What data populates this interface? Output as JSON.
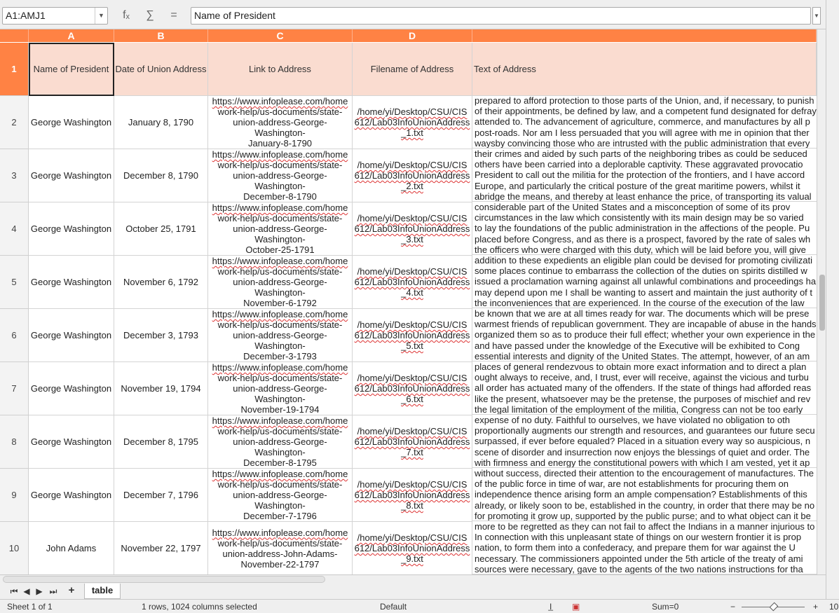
{
  "namebox": {
    "value": "A1:AMJ1"
  },
  "formula": {
    "content": "Name of President",
    "fx_icon": "fₓ",
    "sum_icon": "∑",
    "eq_icon": "="
  },
  "columns": [
    "A",
    "B",
    "C",
    "D",
    ""
  ],
  "header_row": {
    "num": "1",
    "cells": [
      "Name of President",
      "Date of Union Address",
      "Link to Address",
      "Filename of Address",
      "Text of Address"
    ]
  },
  "rows": [
    {
      "num": "2",
      "name": "George Washington",
      "date": "January 8, 1790",
      "link": [
        "https://www.infoplease.com/home",
        "work-help/us-documents/state-",
        "union-address-George-Washington-",
        "January-8-1790"
      ],
      "file": [
        "/home/yi/Desktop/CSU/CIS",
        "612/Lab03InfoUnionAddress",
        "_1.txt"
      ],
      "text": [
        "prepared to afford protection to those parts of the Union, and, if necessary, to punish",
        "of their appointments, be defined by law, and a competent fund designated for defray",
        "attended to.  The advancement of agriculture, commerce, and manufactures by all p",
        "post-roads.  Nor am I less persuaded that you will agree with me in opinion that ther",
        "waysby convincing those who are intrusted with the public administration that every"
      ]
    },
    {
      "num": "3",
      "name": "George Washington",
      "date": "December 8, 1790",
      "link": [
        "https://www.infoplease.com/home",
        "work-help/us-documents/state-",
        "union-address-George-Washington-",
        "December-8-1790"
      ],
      "file": [
        "/home/yi/Desktop/CSU/CIS",
        "612/Lab03InfoUnionAddress",
        "_2.txt"
      ],
      "text": [
        "their crimes and aided by such parts of the neighboring tribes as could be seduced",
        "others have been carried into a deplorable captivity.  These aggravated provocatio",
        "President to call out the militia for the protection of the frontiers, and I have accord",
        "Europe, and particularly the critical posture of the great maritime powers, whilst it",
        "abridge the means, and thereby at least enhance the price, of transporting its valual"
      ]
    },
    {
      "num": "4",
      "name": "George Washington",
      "date": "October 25, 1791",
      "link": [
        "https://www.infoplease.com/home",
        "work-help/us-documents/state-",
        "union-address-George-Washington-",
        "October-25-1791"
      ],
      "file": [
        "/home/yi/Desktop/CSU/CIS",
        "612/Lab03InfoUnionAddress",
        "_3.txt"
      ],
      "text": [
        "considerable part of the United States and a misconception of some of its prov",
        "circumstances in the law which consistently with its main design may be so varied",
        "to lay the foundations of the public administration in the affections of the people.  Pu",
        "placed before Congress, and as there is a prospect, favored by the rate of sales wh",
        "the officers who were charged with this duty, which will be laid before you, will give"
      ]
    },
    {
      "num": "5",
      "name": "George Washington",
      "date": "November 6, 1792",
      "link": [
        "https://www.infoplease.com/home",
        "work-help/us-documents/state-",
        "union-address-George-Washington-",
        "November-6-1792"
      ],
      "file": [
        "/home/yi/Desktop/CSU/CIS",
        "612/Lab03InfoUnionAddress",
        "_4.txt"
      ],
      "text": [
        "addition to these expedients an eligible plan could be devised for promoting civilizati",
        "some places continue to embarrass the collection of the duties on spirits distilled w",
        "issued a proclamation warning against all unlawful combinations and proceedings ha",
        "may depend upon me I shall be wanting to assert and maintain the just authority of t",
        "the inconveniences that are experienced. In the course of the execution of the law"
      ]
    },
    {
      "num": "6",
      "name": "George Washington",
      "date": "December 3, 1793",
      "link": [
        "https://www.infoplease.com/home",
        "work-help/us-documents/state-",
        "union-address-George-Washington-",
        "December-3-1793"
      ],
      "file": [
        "/home/yi/Desktop/CSU/CIS",
        "612/Lab03InfoUnionAddress",
        "_5.txt"
      ],
      "text": [
        "be known that we are at all times ready for war. The documents which will be prese",
        "warmest friends of republican government. They are incapable of abuse in the hands",
        "organized them so as to produce their full effect; whether your own experience in the",
        "and have passed under the knowledge of the Executive will be exhibited to Cong",
        "essential interests and dignity of the United States. The attempt, however, of an am"
      ]
    },
    {
      "num": "7",
      "name": "George Washington",
      "date": "November 19, 1794",
      "link": [
        "https://www.infoplease.com/home",
        "work-help/us-documents/state-",
        "union-address-George-Washington-",
        "November-19-1794"
      ],
      "file": [
        "/home/yi/Desktop/CSU/CIS",
        "612/Lab03InfoUnionAddress",
        "_6.txt"
      ],
      "text": [
        "places of general rendezvous to obtain more exact information and to direct a plan",
        "ought always to receive, and, I trust, ever will receive, against the vicious and turbu",
        "all order has actuated many of the offenders. If the state of things had afforded reas",
        "like the present, whatsoever may be the pretense, the purposes of mischief and rev",
        "the legal limitation of the employment of the militia, Congress can not be too early"
      ]
    },
    {
      "num": "8",
      "name": "George Washington",
      "date": "December 8, 1795",
      "link": [
        "https://www.infoplease.com/home",
        "work-help/us-documents/state-",
        "union-address-George-Washington-",
        "December-8-1795"
      ],
      "file": [
        "/home/yi/Desktop/CSU/CIS",
        "612/Lab03InfoUnionAddress",
        "_7.txt"
      ],
      "text": [
        "expense of no duty. Faithful to ourselves, we have violated no obligation to oth",
        "proportionally augments our strength and resources, and guarantees our future secu",
        "surpassed, if ever before equaled?  Placed in a situation every way so auspicious, n",
        "scene of disorder and insurrection now enjoys the blessings of quiet and order. The",
        "with firmness and energy the constitutional powers with which I am vested, yet it ap"
      ]
    },
    {
      "num": "9",
      "name": "George Washington",
      "date": "December 7, 1796",
      "link": [
        "https://www.infoplease.com/home",
        "work-help/us-documents/state-",
        "union-address-George-Washington-",
        "December-7-1796"
      ],
      "file": [
        "/home/yi/Desktop/CSU/CIS",
        "612/Lab03InfoUnionAddress",
        "_8.txt"
      ],
      "text": [
        "without success, directed their attention to the encouragement of manufactures. The",
        "of the public force in time of war, are not establishments for procuring them on",
        "independence thence arising form an ample compensation?  Establishments of this",
        "already, or likely soon to be, established in the country, in order that there may be no",
        "for promoting it grow up, supported by the public purse; and to what object can it be"
      ]
    },
    {
      "num": "10",
      "name": "John Adams",
      "date": "November 22, 1797",
      "link": [
        "https://www.infoplease.com/home",
        "work-help/us-documents/state-",
        "union-address-John-Adams-",
        "November-22-1797"
      ],
      "file": [
        "/home/yi/Desktop/CSU/CIS",
        "612/Lab03InfoUnionAddress",
        "_9.txt"
      ],
      "text": [
        "more to be regretted as they can not fail to affect the Indians in a manner injurious to",
        "In connection with this unpleasant state of things on our western frontier it is prop",
        "nation, to form them into a confederacy, and prepare them for war against the U",
        "necessary.  The commissioners appointed under the 5th article of the treaty of ami",
        "sources were necessary, gave to the agents of the two nations instructions for tha"
      ]
    }
  ],
  "tabs": {
    "add_icon": "+",
    "sheet_name": "table"
  },
  "status": {
    "sheet": "Sheet 1 of 1",
    "selection": "1 rows, 1024 columns selected",
    "style": "Default",
    "sum": "Sum=0",
    "zoom_minus": "−",
    "zoom_plus": "+",
    "zoom_value": "10"
  }
}
